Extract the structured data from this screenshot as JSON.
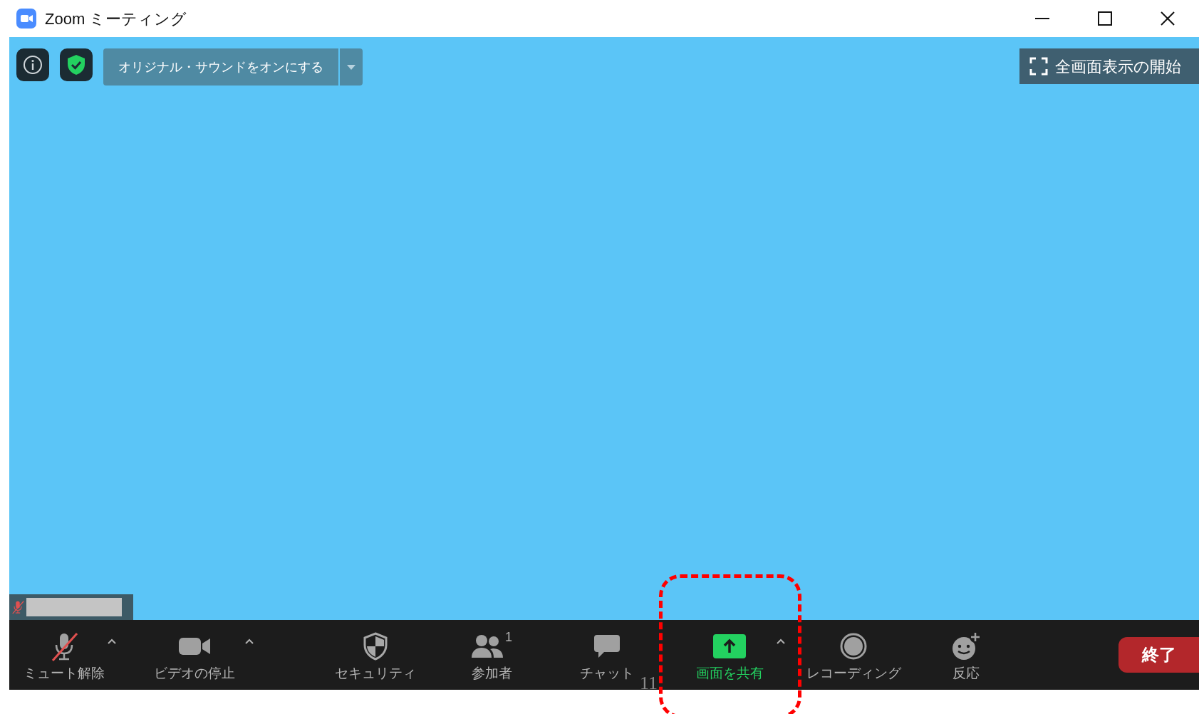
{
  "window": {
    "title": "Zoom ミーティング"
  },
  "top_bar": {
    "sound_button": "オリジナル・サウンドをオンにする",
    "fullscreen_button": "全画面表示の開始"
  },
  "self_tile": {
    "muted": true
  },
  "toolbar": [
    {
      "kind": "mic",
      "label": "ミュート解除",
      "muted": true,
      "has_menu": true,
      "highlighted": false,
      "annotated": false
    },
    {
      "kind": "video",
      "label": "ビデオの停止",
      "has_menu": true,
      "highlighted": false,
      "annotated": false
    },
    {
      "kind": "security",
      "label": "セキュリティ",
      "has_menu": false,
      "highlighted": false,
      "annotated": false
    },
    {
      "kind": "participants",
      "label": "参加者",
      "count": "1",
      "has_menu": false,
      "highlighted": false,
      "annotated": false
    },
    {
      "kind": "chat",
      "label": "チャット",
      "has_menu": false,
      "highlighted": false,
      "annotated": false
    },
    {
      "kind": "share",
      "label": "画面を共有",
      "has_menu": true,
      "highlighted": true,
      "annotated": true
    },
    {
      "kind": "record",
      "label": "レコーディング",
      "has_menu": false,
      "highlighted": false,
      "annotated": false
    },
    {
      "kind": "reactions",
      "label": "反応",
      "has_menu": false,
      "highlighted": false,
      "annotated": false
    }
  ],
  "end_button": "終了",
  "overlay_text": "11"
}
